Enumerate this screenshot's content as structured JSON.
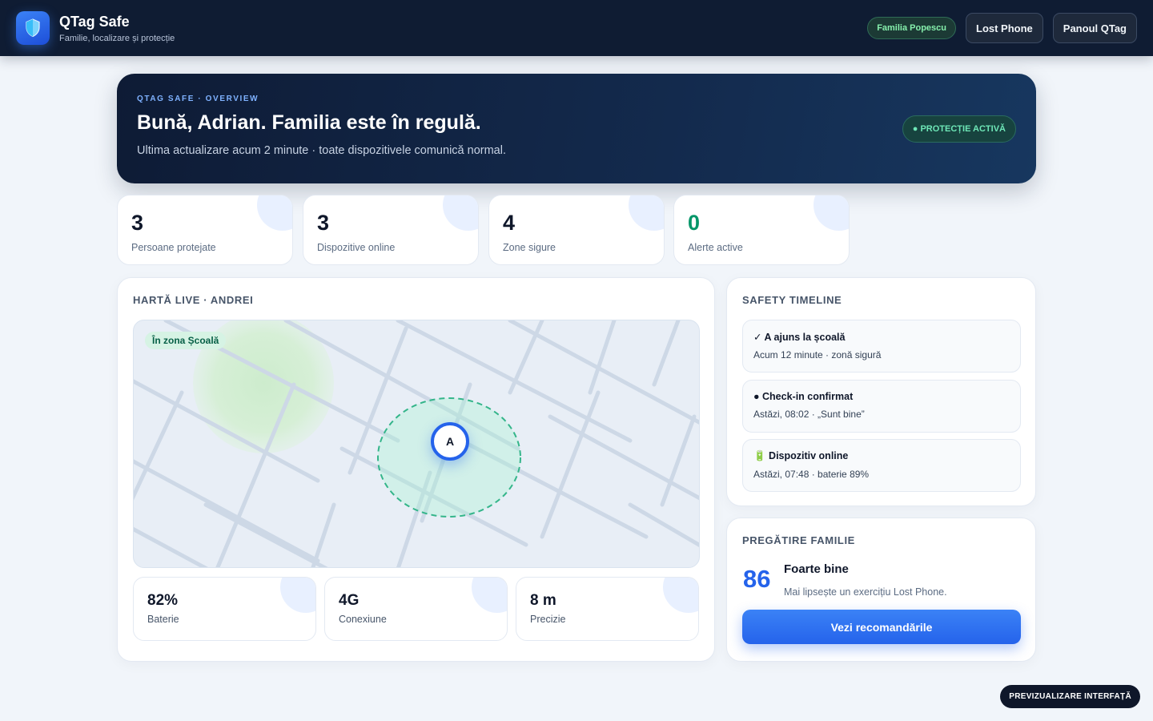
{
  "header": {
    "app_name": "QTag Safe",
    "tagline": "Familie, localizare și protecție",
    "logo_icon": "shield-icon",
    "family_badge": "Familia Popescu",
    "lost_phone_label": "Lost Phone",
    "panel_label": "Panoul QTag"
  },
  "hero": {
    "eyebrow": "QTAG SAFE · OVERVIEW",
    "title": "Bună, Adrian. Familia este în regulă.",
    "subtitle": "Ultima actualizare acum 2 minute · toate dispozitivele comunică normal.",
    "status_pill": "● PROTECȚIE ACTIVĂ"
  },
  "stats": [
    {
      "value": "3",
      "label": "Persoane protejate"
    },
    {
      "value": "3",
      "label": "Dispozitive online"
    },
    {
      "value": "4",
      "label": "Zone sigure"
    },
    {
      "value": "0",
      "label": "Alerte active"
    }
  ],
  "map_panel": {
    "title": "HARTĂ LIVE · ANDREI",
    "zone_tag": "În zona Școală",
    "marker_initial": "A",
    "metrics": [
      {
        "value": "82%",
        "label": "Baterie"
      },
      {
        "value": "4G",
        "label": "Conexiune"
      },
      {
        "value": "8 m",
        "label": "Precizie"
      }
    ]
  },
  "timeline": {
    "title": "SAFETY TIMELINE",
    "items": [
      {
        "title": "✓ A ajuns la școală",
        "detail": "Acum 12 minute · zonă sigură"
      },
      {
        "title": "● Check-in confirmat",
        "detail": "Astăzi, 08:02 · „Sunt bine”"
      },
      {
        "title": "🔋 Dispozitiv online",
        "detail": "Astăzi, 07:48 · baterie 89%"
      }
    ]
  },
  "preparedness": {
    "title": "PREGĂTIRE FAMILIE",
    "score": "86",
    "level": "Foarte bine",
    "note": "Mai lipsește un exercițiu Lost Phone.",
    "button_label": "Vezi recomandările"
  },
  "preview_badge": "PREVIZUALIZARE INTERFAȚĂ",
  "colors": {
    "accent": "#2563eb",
    "header_bg": "#0f1c33",
    "success": "#059669",
    "page_bg": "#f1f5fa"
  }
}
